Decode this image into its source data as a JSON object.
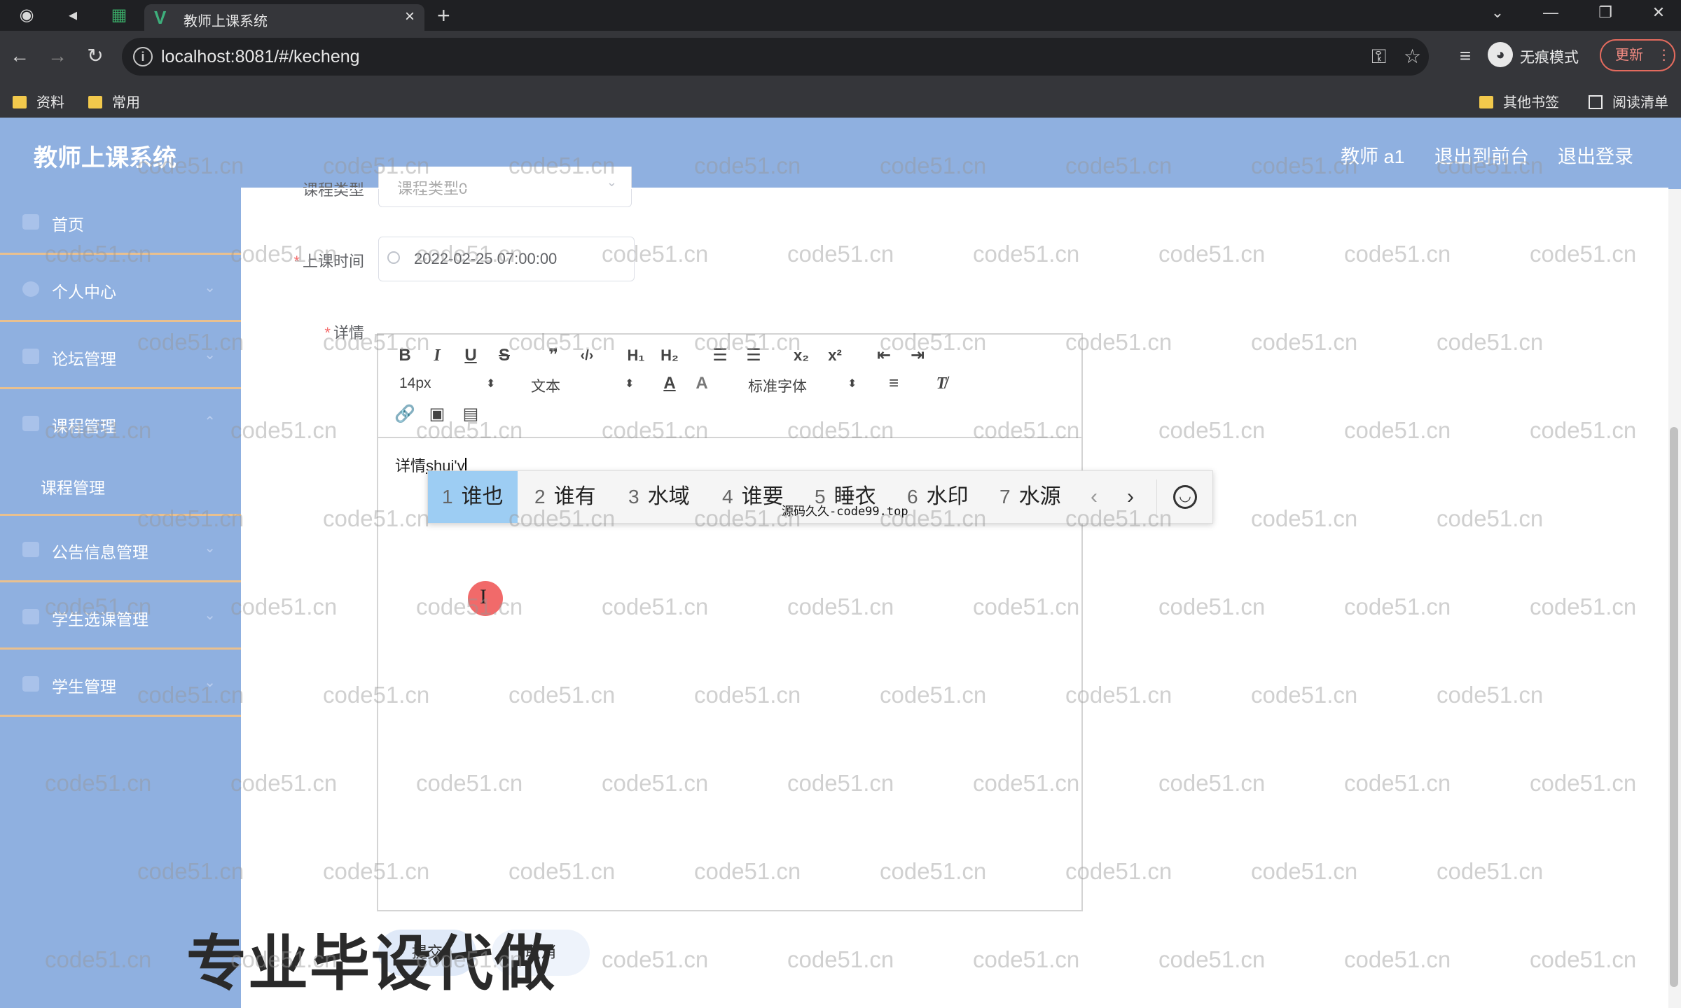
{
  "browser": {
    "tab_title": "教师上课系统",
    "tab_close": "×",
    "new_tab": "+",
    "url": "localhost:8081/#/kecheng",
    "incognito_label": "无痕模式",
    "update_label": "更新",
    "bookmarks": [
      "资料",
      "常用"
    ],
    "other_bookmarks": "其他书签",
    "reading_list": "阅读清单"
  },
  "header": {
    "title": "教师上课系统",
    "user": "教师 a1",
    "back_to_front": "退出到前台",
    "logout": "退出登录"
  },
  "sidebar": {
    "items": [
      {
        "label": "首页",
        "icon": "home-icon"
      },
      {
        "label": "个人中心",
        "icon": "user-icon"
      },
      {
        "label": "论坛管理",
        "icon": "forum-icon"
      },
      {
        "label": "课程管理",
        "icon": "course-icon"
      },
      {
        "label": "公告信息管理",
        "icon": "notice-icon"
      },
      {
        "label": "学生选课管理",
        "icon": "enroll-icon"
      },
      {
        "label": "学生管理",
        "icon": "student-icon"
      }
    ],
    "sub_item": "课程管理"
  },
  "form": {
    "course_type_label": "课程类型",
    "course_type_value": "课程类型0",
    "time_label": "上课时间",
    "time_value": "2022-02-25 07:00:00",
    "detail_label": "详情",
    "required_mark": "*"
  },
  "editor": {
    "font_size": "14px",
    "header_select": "文本",
    "font_family": "标准字体",
    "content_prefix": "详情",
    "composing": "shui'y"
  },
  "ime": {
    "candidates": [
      {
        "num": "1",
        "text": "谁也"
      },
      {
        "num": "2",
        "text": "谁有"
      },
      {
        "num": "3",
        "text": "水域"
      },
      {
        "num": "4",
        "text": "谁要"
      },
      {
        "num": "5",
        "text": "睡衣"
      },
      {
        "num": "6",
        "text": "水印"
      },
      {
        "num": "7",
        "text": "水源"
      }
    ],
    "prev": "‹",
    "next": "›",
    "note": "源码久久-code99.top"
  },
  "buttons": {
    "submit": "提交",
    "cancel": "取消"
  },
  "overlay": {
    "promo": "专业毕设代做",
    "watermark": "code51.cn"
  },
  "colors": {
    "header_bg": "#8fb0e0",
    "divider": "#e9c08f",
    "ime_selected": "#9dcdf3",
    "required": "#f56c6c"
  }
}
